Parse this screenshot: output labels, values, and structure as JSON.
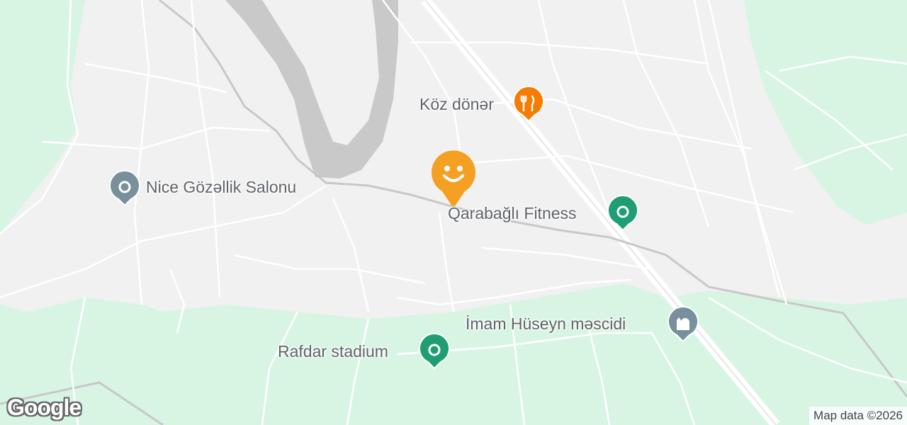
{
  "map": {
    "pois": [
      {
        "label": "Nice Gözəllik Salonu",
        "icon": "place-icon",
        "color": "#78909c"
      },
      {
        "label": "Köz dönər",
        "icon": "restaurant-icon",
        "color": "#f57c00"
      },
      {
        "label": "Qarabağlı Fitness",
        "icon": "fitness-icon",
        "color": "#1e9e72"
      },
      {
        "label": "İmam Hüseyn məscidi",
        "icon": "mosque-icon",
        "color": "#78909c"
      },
      {
        "label": "Rafdar stadium",
        "icon": "stadium-icon",
        "color": "#1e9e72"
      }
    ],
    "selected_marker": {
      "icon": "smiley-marker-icon",
      "color": "#f4a023"
    },
    "attribution": "Map data ©2026",
    "logo": "Google"
  }
}
